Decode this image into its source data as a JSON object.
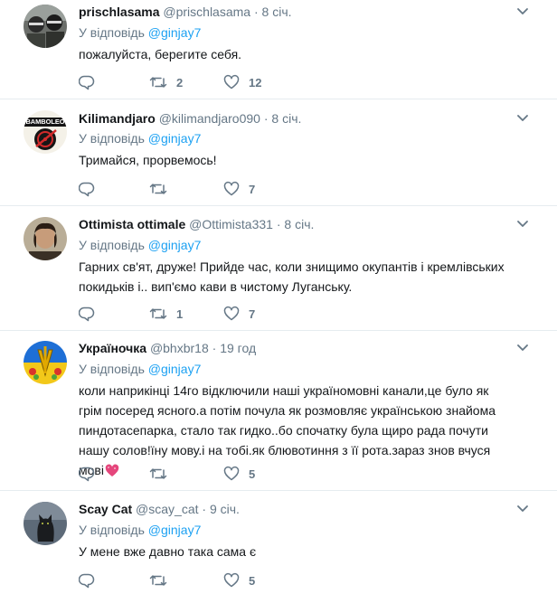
{
  "reply_prefix": "У відповідь",
  "colors": {
    "link": "#1da1f2",
    "secondary": "#657786",
    "text": "#14171a",
    "divider": "#e6ecf0"
  },
  "tweets": [
    {
      "name": "prischlasama",
      "handle": "@prischlasama",
      "dot": "·",
      "time": "8 січ.",
      "reply_to": "@ginjay7",
      "text": "пожалуйста, берегите себя.",
      "retweets": "2",
      "likes": "12",
      "avatar_icon": "masked-people-avatar"
    },
    {
      "name": "Kilimandjaro",
      "handle": "@kilimandjaro090",
      "dot": "·",
      "time": "8 січ.",
      "reply_to": "@ginjay7",
      "text": "Тримайся, прорвемось!",
      "retweets": "",
      "likes": "7",
      "avatar_icon": "bamboleo-guitar-avatar",
      "avatar_text": "BAMBOLEO"
    },
    {
      "name": "Ottimista ottimale",
      "handle": "@Ottimista331",
      "dot": "·",
      "time": "8 січ.",
      "reply_to": "@ginjay7",
      "text": "Гарних св'ят, друже! Прийде час, коли знищимо окупантів і кремлівських покидьків і.. вип'ємо кави в чистому Луганську.",
      "retweets": "1",
      "likes": "7",
      "avatar_icon": "man-portrait-avatar"
    },
    {
      "name": "Україночка",
      "handle": "@bhxbr18",
      "dot": "·",
      "time": "19 год",
      "reply_to": "@ginjay7",
      "text": "коли наприкінці 14го відключили наші україномовні канали,це було як грім посеред ясного.а потім почула як розмовляє українською знайома пиндотасепарка, стало так гидко..бо спочатку була щиро рада почути нашу солов!їну мову.і на тобі.як блювотиння з її рота.зараз знов вчуся мові",
      "retweets": "",
      "likes": "5",
      "avatar_icon": "ukrainian-emblem-avatar",
      "emoji_icon": "sparkling-heart-icon"
    },
    {
      "name": "Scay Cat",
      "handle": "@scay_cat",
      "dot": "·",
      "time": "9 січ.",
      "reply_to": "@ginjay7",
      "text": "У мене вже давно така сама є",
      "retweets": "",
      "likes": "5",
      "avatar_icon": "black-cat-avatar"
    }
  ]
}
